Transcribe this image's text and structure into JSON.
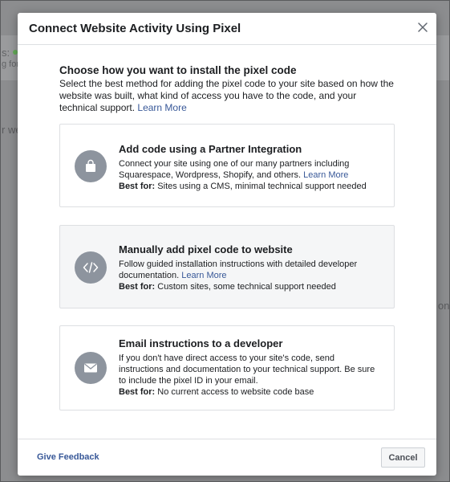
{
  "background": {
    "fragments": [
      "s:",
      "g for",
      "r we",
      "on"
    ]
  },
  "modal": {
    "title": "Connect Website Activity Using Pixel",
    "close_icon": "close-icon",
    "intro": {
      "heading": "Choose how you want to install the pixel code",
      "description": "Select the best method for adding the pixel code to your site based on how the website was built, what kind of access you have to the code, and your technical support.",
      "learn_more": "Learn More"
    },
    "options": [
      {
        "icon": "shopping-bag-icon",
        "title": "Add code using a Partner Integration",
        "description": "Connect your site using one of our many partners including Squarespace, Wordpress, Shopify, and others.",
        "learn_more": "Learn More",
        "best_for_label": "Best for:",
        "best_for": "Sites using a CMS, minimal technical support needed"
      },
      {
        "icon": "code-icon",
        "title": "Manually add pixel code to website",
        "description": "Follow guided installation instructions with detailed developer documentation.",
        "learn_more": "Learn More",
        "best_for_label": "Best for:",
        "best_for": "Custom sites, some technical support needed"
      },
      {
        "icon": "envelope-icon",
        "title": "Email instructions to a developer",
        "description": "If you don't have direct access to your site's code, send instructions and documentation to your technical support. Be sure to include the pixel ID in your email.",
        "best_for_label": "Best for:",
        "best_for": "No current access to website code base"
      }
    ],
    "footer": {
      "feedback": "Give Feedback",
      "cancel": "Cancel"
    }
  },
  "colors": {
    "link": "#385898",
    "icon_circle": "#8d949e",
    "status_dot": "#42b72a"
  }
}
